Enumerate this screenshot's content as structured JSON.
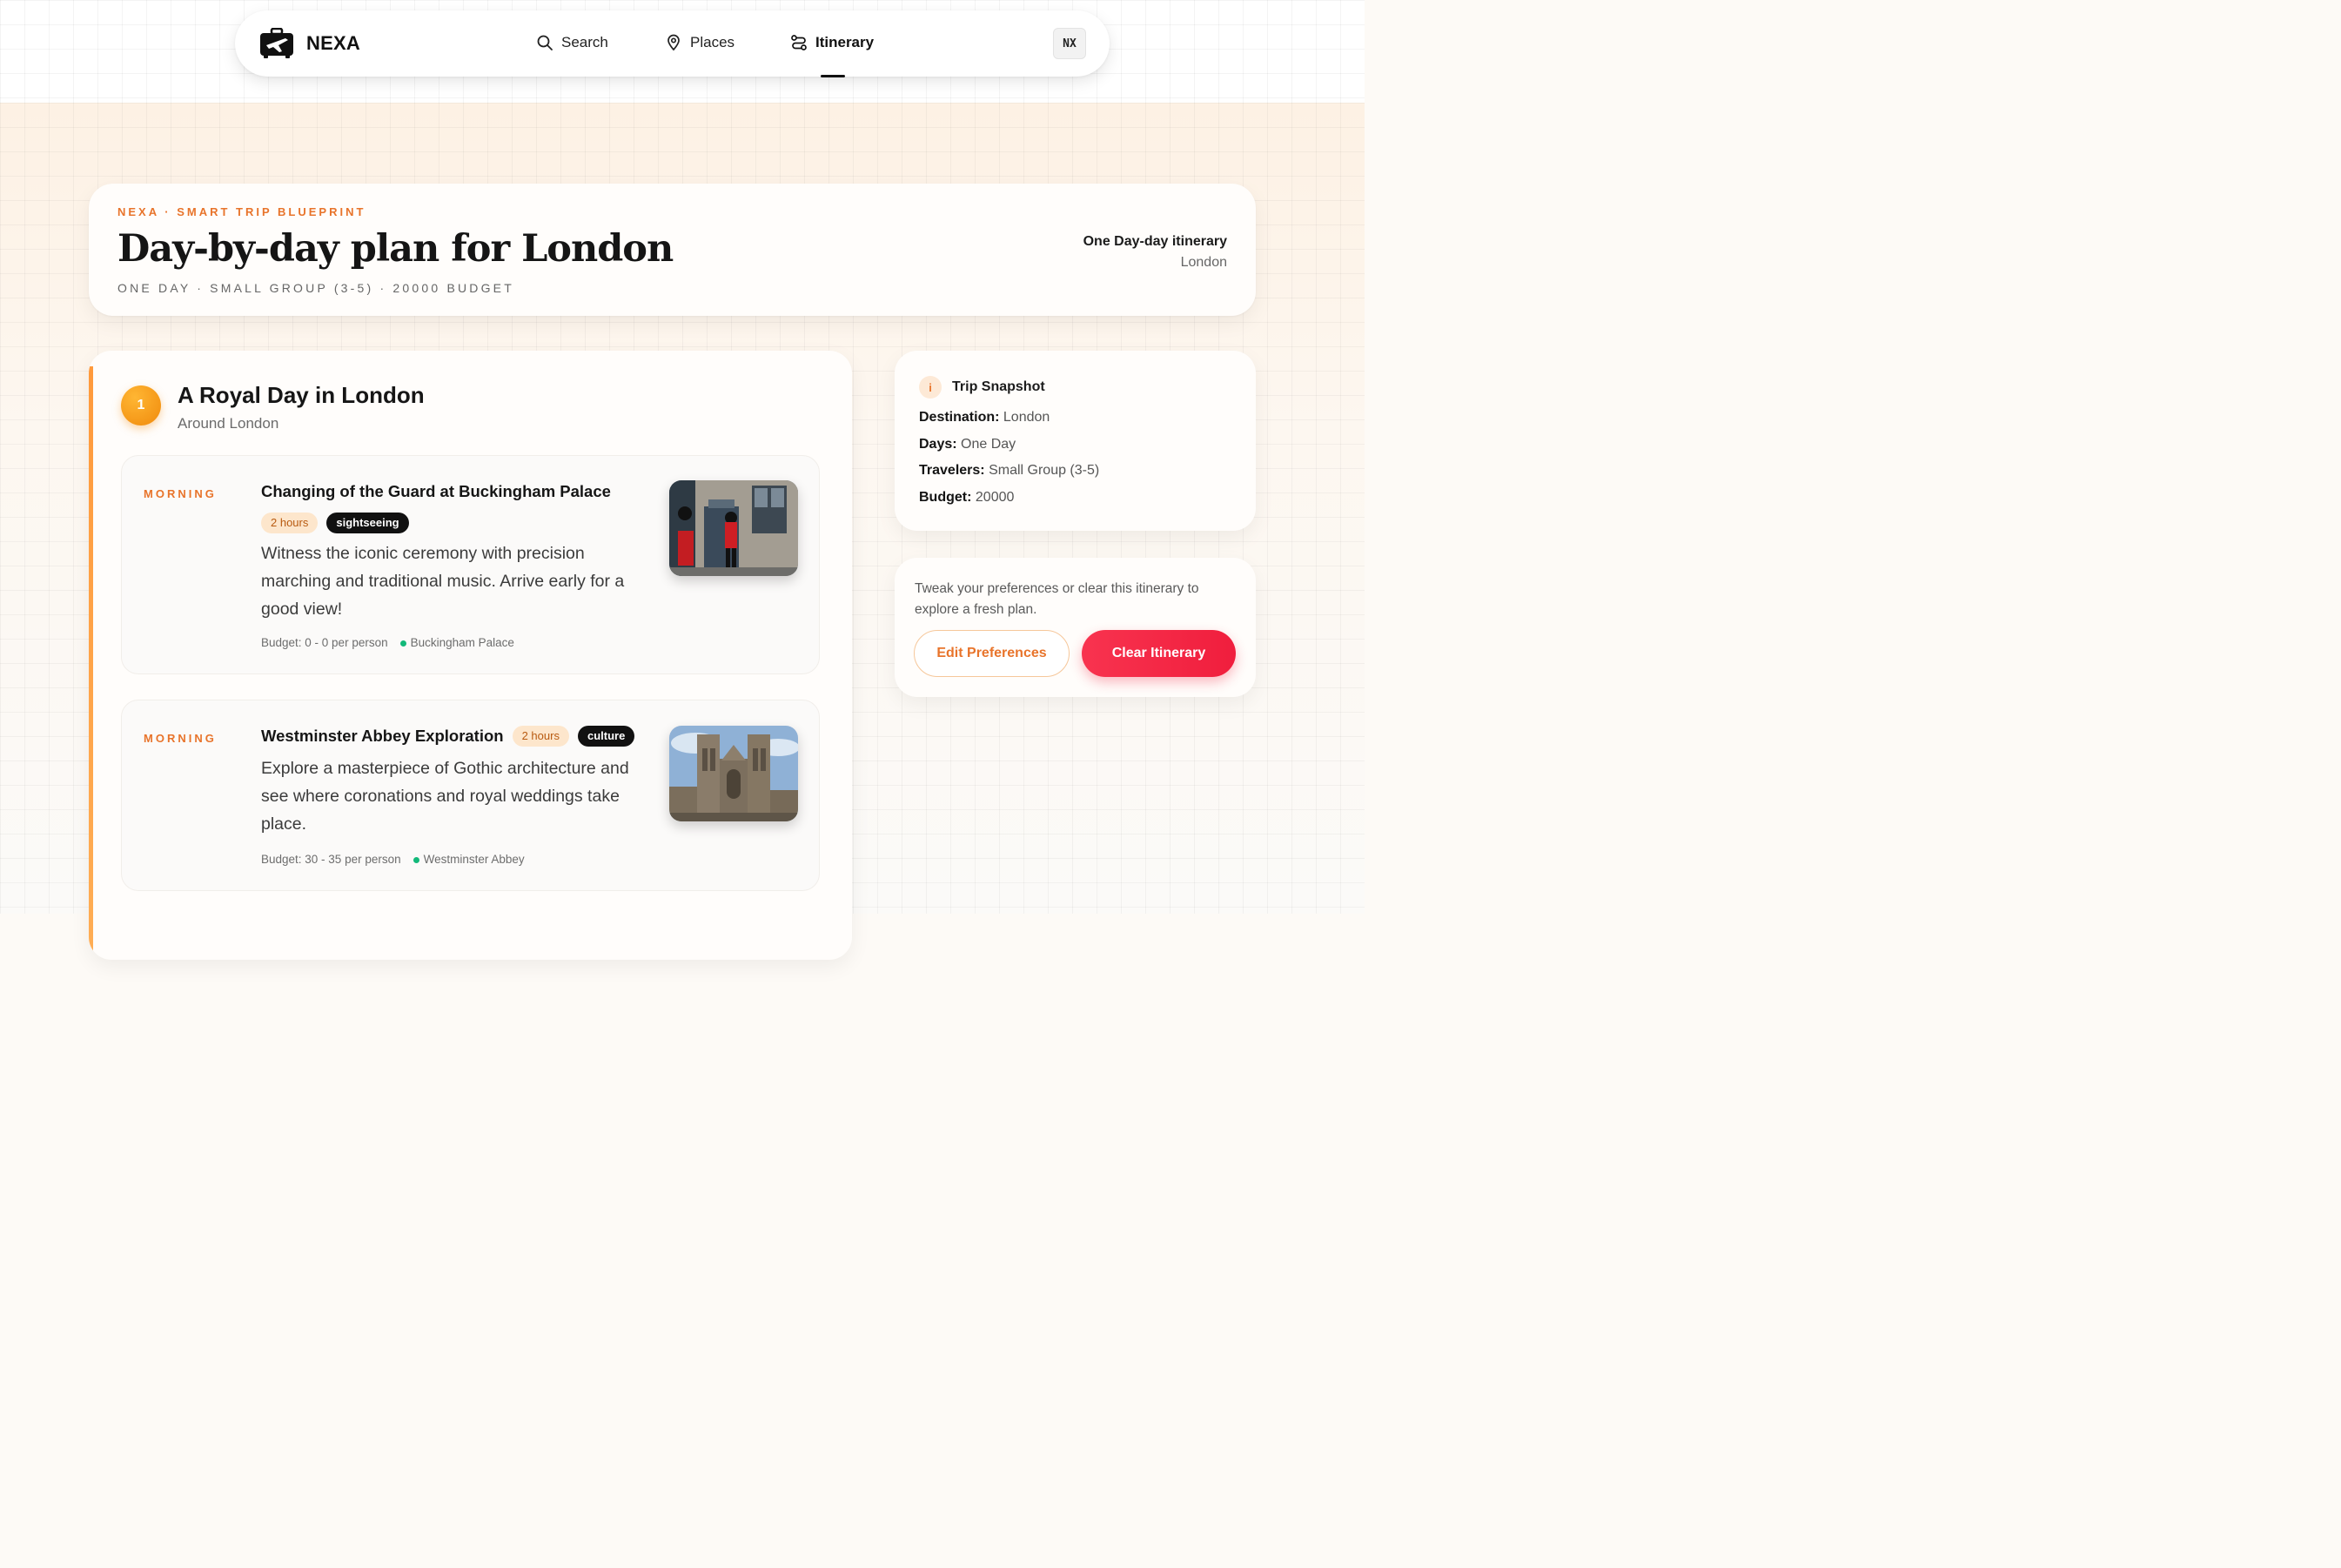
{
  "nav": {
    "brand": "NEXA",
    "items": [
      {
        "label": "Search",
        "icon": "search-icon"
      },
      {
        "label": "Places",
        "icon": "map-pin-icon"
      },
      {
        "label": "Itinerary",
        "icon": "route-icon",
        "active": true
      }
    ],
    "avatar": "NX"
  },
  "hero": {
    "eyebrow": "NEXA · SMART TRIP BLUEPRINT",
    "title": "Day-by-day plan for London",
    "meta": "ONE DAY · SMALL GROUP (3-5) · 20000 BUDGET",
    "right_title": "One Day-day itinerary",
    "right_sub": "London"
  },
  "day": {
    "number": "1",
    "title": "A Royal Day in London",
    "subtitle": "Around London",
    "activities": [
      {
        "time": "MORNING",
        "name": "Changing of the Guard at Buckingham Palace",
        "duration": "2 hours",
        "tag": "sightseeing",
        "description": "Witness the iconic ceremony with precision marching and traditional music. Arrive early for a good view!",
        "budget": "Budget: 0 - 0 per person",
        "location": "Buckingham Palace"
      },
      {
        "time": "MORNING",
        "name": "Westminster Abbey Exploration",
        "duration": "2 hours",
        "tag": "culture",
        "description": "Explore a masterpiece of Gothic architecture and see where coronations and royal weddings take place.",
        "budget": "Budget: 30 - 35 per person",
        "location": "Westminster Abbey"
      }
    ]
  },
  "snapshot": {
    "title": "Trip Snapshot",
    "info_icon": "i",
    "rows": [
      {
        "label": "Destination:",
        "value": "London"
      },
      {
        "label": "Days:",
        "value": "One Day"
      },
      {
        "label": "Travelers:",
        "value": "Small Group (3-5)"
      },
      {
        "label": "Budget:",
        "value": "20000"
      }
    ]
  },
  "actions": {
    "text": "Tweak your preferences or clear this itinerary to explore a fresh plan.",
    "edit_label": "Edit Preferences",
    "clear_label": "Clear Itinerary"
  },
  "colors": {
    "accent": "#e8742b",
    "clear": "#f01e3d",
    "location_dot": "#13b97a"
  }
}
